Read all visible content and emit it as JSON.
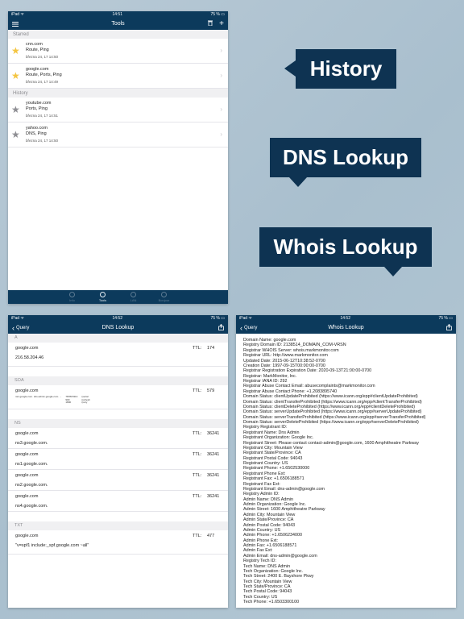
{
  "tools_panel": {
    "status": {
      "left": "iPad ᯤ",
      "center": "14:51",
      "right": "75 % ▭"
    },
    "title": "Tools",
    "starred_header": "Starred",
    "history_header": "History",
    "starred": [
      {
        "host": "cnn.com",
        "tools": "Route, Ping",
        "date": "března 24, 17 14:50"
      },
      {
        "host": "google.com",
        "tools": "Route, Ports, Ping",
        "date": "března 24, 17 14:49"
      }
    ],
    "history": [
      {
        "host": "youtube.com",
        "tools": "Ports, Ping",
        "date": "března 24, 17 14:51"
      },
      {
        "host": "yahoo.com",
        "tools": "DNS, Ping",
        "date": "března 24, 17 14:50"
      }
    ],
    "tabs": [
      "Info",
      "Tools",
      "LAN",
      "Bonjour"
    ]
  },
  "callouts": {
    "history": "History",
    "dns": "DNS Lookup",
    "whois": "Whois Lookup"
  },
  "dns_panel": {
    "status": {
      "left": "iPad ᯤ",
      "center": "14:52",
      "right": "75 % ▭"
    },
    "back": "Query",
    "title": "DNS Lookup",
    "ttl_label": "TTL:",
    "a_header": "A",
    "a_record": {
      "host": "google.com",
      "ttl": "174",
      "value": "216.58.204.46"
    },
    "soa_header": "SOA",
    "soa_record": {
      "host": "google.com",
      "ttl": "579"
    },
    "soa_detail": {
      "col1": "ns1.google.com. dns-admin.google.com. ...",
      "col2a": "787815314",
      "col2b": "900",
      "col2c": "1800",
      "col3a": "(serial",
      "col3b": "(refresh",
      "col3c": "(retry"
    },
    "ns_header": "NS",
    "ns_records": [
      {
        "host": "google.com",
        "ttl": "36241",
        "value": "ns3.google.com."
      },
      {
        "host": "google.com",
        "ttl": "36241",
        "value": "ns1.google.com."
      },
      {
        "host": "google.com",
        "ttl": "36241",
        "value": "ns2.google.com."
      },
      {
        "host": "google.com",
        "ttl": "36241",
        "value": "ns4.google.com."
      }
    ],
    "txt_header": "TXT",
    "txt_record": {
      "host": "google.com",
      "ttl": "477",
      "value": "\"v=spf1 include:_spf.google.com ~all\""
    }
  },
  "whois_panel": {
    "status": {
      "left": "iPad ᯤ",
      "center": "14:52",
      "right": "75 % ▭"
    },
    "back": "Query",
    "title": "Whois Lookup",
    "text": "Domain Name: google.com\nRegistry Domain ID: 2138514_DOMAIN_COM-VRSN\nRegistrar WHOIS Server: whois.markmonitor.com\nRegistrar URL: http://www.markmonitor.com\nUpdated Date: 2015-06-12T10:38:52-0700\nCreation Date: 1997-09-15T00:00:00-0700\nRegistrar Registration Expiration Date: 2020-09-13T21:00:00-0700\nRegistrar: MarkMonitor, Inc.\nRegistrar IANA ID: 292\nRegistrar Abuse Contact Email: abusecomplaints@markmonitor.com\nRegistrar Abuse Contact Phone: +1.2083895740\nDomain Status: clientUpdateProhibited (https://www.icann.org/epp#clientUpdateProhibited)\nDomain Status: clientTransferProhibited (https://www.icann.org/epp#clientTransferProhibited)\nDomain Status: clientDeleteProhibited (https://www.icann.org/epp#clientDeleteProhibited)\nDomain Status: serverUpdateProhibited (https://www.icann.org/epp#serverUpdateProhibited)\nDomain Status: serverTransferProhibited (https://www.icann.org/epp#serverTransferProhibited)\nDomain Status: serverDeleteProhibited (https://www.icann.org/epp#serverDeleteProhibited)\nRegistry Registrant ID:\nRegistrant Name: Dns Admin\nRegistrant Organization: Google Inc.\nRegistrant Street: Please contact contact-admin@google.com, 1600 Amphitheatre Parkway\nRegistrant City: Mountain View\nRegistrant State/Province: CA\nRegistrant Postal Code: 94043\nRegistrant Country: US\nRegistrant Phone: +1.6502530000\nRegistrant Phone Ext:\nRegistrant Fax: +1.6506188571\nRegistrant Fax Ext:\nRegistrant Email: dns-admin@google.com\nRegistry Admin ID:\nAdmin Name: DNS Admin\nAdmin Organization: Google Inc.\nAdmin Street: 1600 Amphitheatre Parkway\nAdmin City: Mountain View\nAdmin State/Province: CA\nAdmin Postal Code: 94043\nAdmin Country: US\nAdmin Phone: +1.6506234000\nAdmin Phone Ext:\nAdmin Fax: +1.6506188571\nAdmin Fax Ext:\nAdmin Email: dns-admin@google.com\nRegistry Tech ID:\nTech Name: DNS Admin\nTech Organization: Google Inc.\nTech Street: 2400 E. Bayshore Pkwy\nTech City: Mountain View\nTech State/Province: CA\nTech Postal Code: 94043\nTech Country: US\nTech Phone: +1.6503300100"
  }
}
